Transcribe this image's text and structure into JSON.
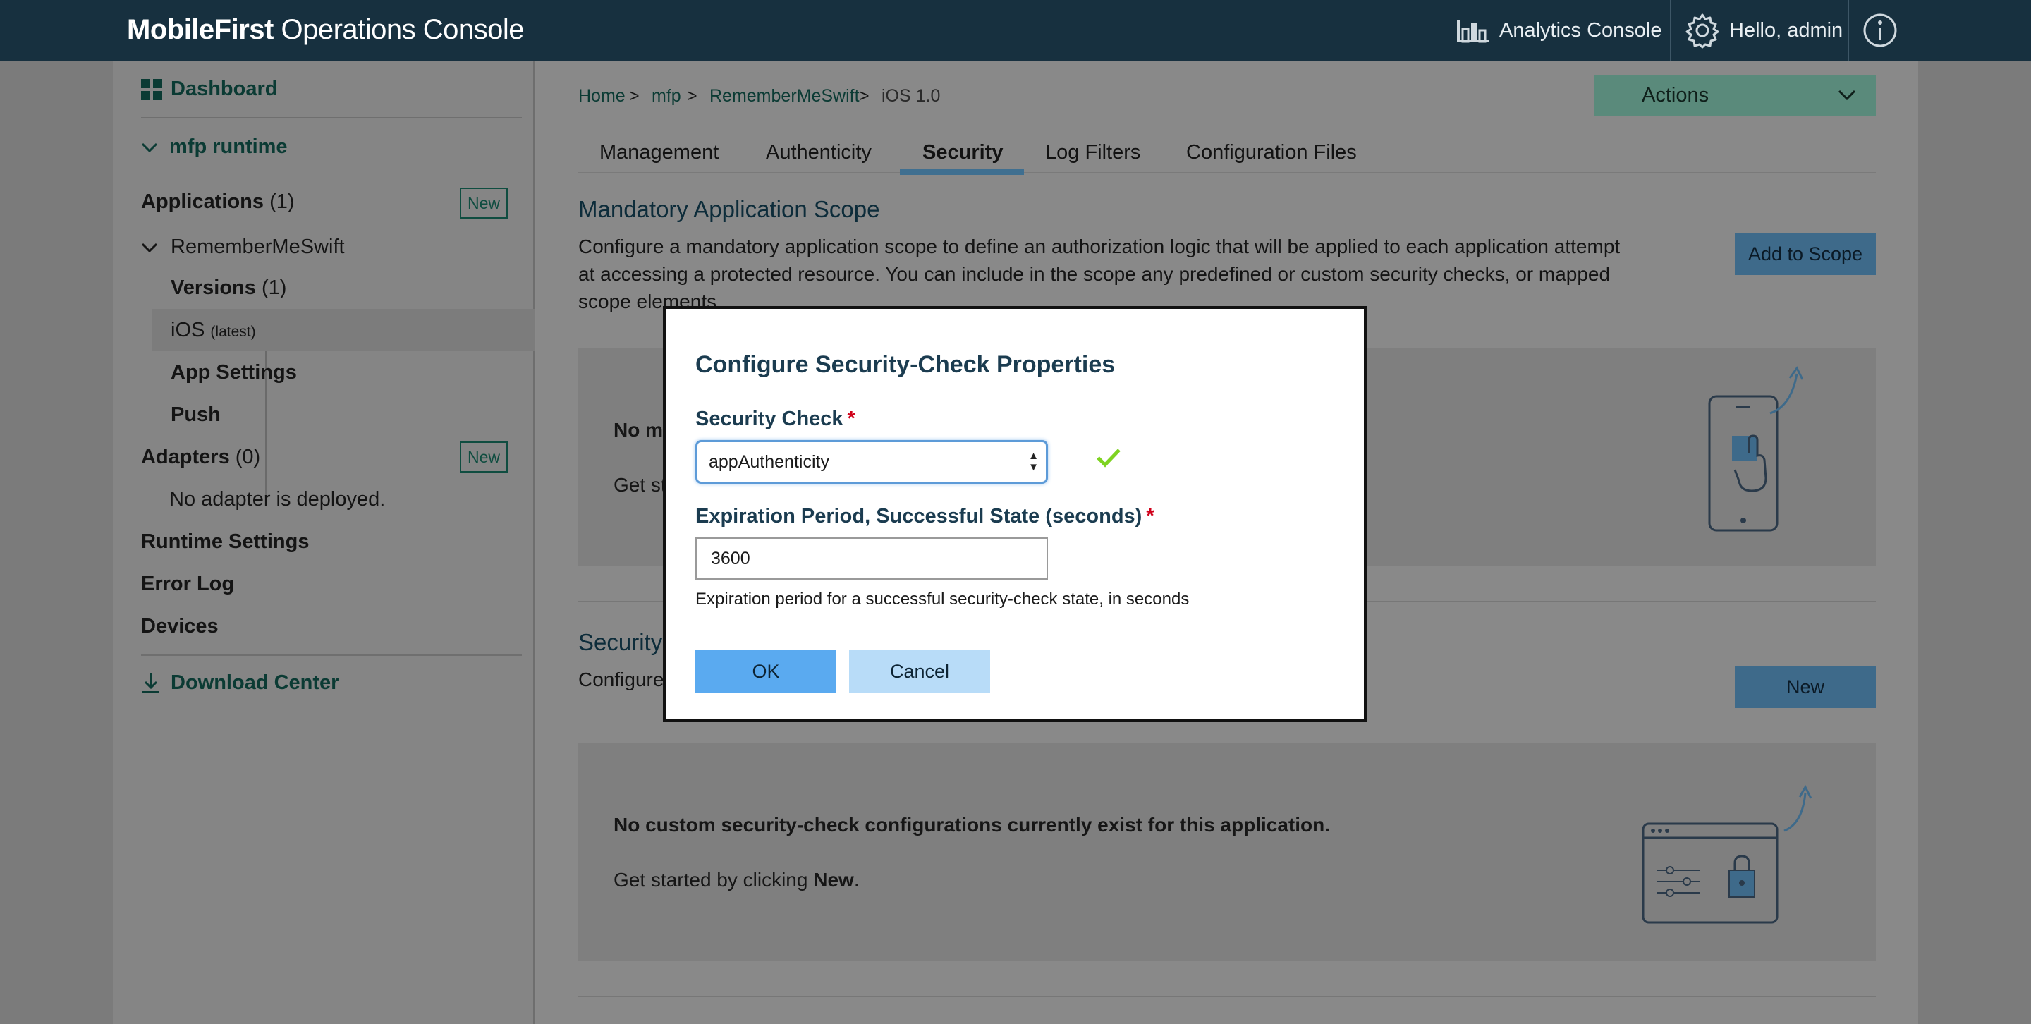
{
  "header": {
    "brand_bold": "MobileFirst",
    "brand_rest": "Operations Console",
    "analytics_label": "Analytics Console",
    "user_label": "Hello, admin"
  },
  "sidebar": {
    "dashboard": "Dashboard",
    "runtime": "mfp runtime",
    "applications_label": "Applications",
    "applications_count": "(1)",
    "new_label": "New",
    "app_name": "RememberMeSwift",
    "versions_label": "Versions",
    "versions_count": "(1)",
    "ios_label": "iOS",
    "ios_tag": "(latest)",
    "app_settings": "App Settings",
    "push": "Push",
    "adapters_label": "Adapters",
    "adapters_count": "(0)",
    "no_adapter": "No adapter is deployed.",
    "runtime_settings": "Runtime Settings",
    "error_log": "Error Log",
    "devices": "Devices",
    "download_center": "Download Center"
  },
  "breadcrumb": {
    "items": [
      "Home",
      "mfp",
      "RememberMeSwift"
    ],
    "sep": ">",
    "current": "iOS 1.0"
  },
  "actions_label": "Actions",
  "tabs": [
    "Management",
    "Authenticity",
    "Security",
    "Log Filters",
    "Configuration Files"
  ],
  "scope": {
    "title": "Mandatory Application Scope",
    "desc_line1": "Configure a mandatory application scope to define an authorization logic that will be applied to each application attempt",
    "desc_line2": "at accessing a protected resource. You can include in the scope any predefined or custom security checks, or mapped",
    "desc_line3": "scope elements.",
    "add_button": "Add to Scope",
    "panel_title_partial": "No m",
    "panel_sub_partial": "Get st"
  },
  "security_checks": {
    "title_partial": "Security-",
    "desc_partial": "Configure",
    "new_button": "New",
    "empty_title": "No custom security-check configurations currently exist for this application.",
    "empty_sub_prefix": "Get started by clicking",
    "empty_sub_bold": "New",
    "empty_sub_suffix": "."
  },
  "modal": {
    "title": "Configure Security-Check Properties",
    "security_check_label": "Security Check",
    "required_mark": "*",
    "security_check_value": "appAuthenticity",
    "expiration_label": "Expiration Period, Successful State (seconds)",
    "expiration_value": "3600",
    "expiration_help": "Expiration period for a successful security-check state, in seconds",
    "ok_label": "OK",
    "cancel_label": "Cancel"
  },
  "colors": {
    "header_bg": "#17303f",
    "accent_green": "#0b3b34",
    "primary_button": "#5aaaf0",
    "check_green": "#7ed321",
    "required_red": "#d0021b"
  }
}
